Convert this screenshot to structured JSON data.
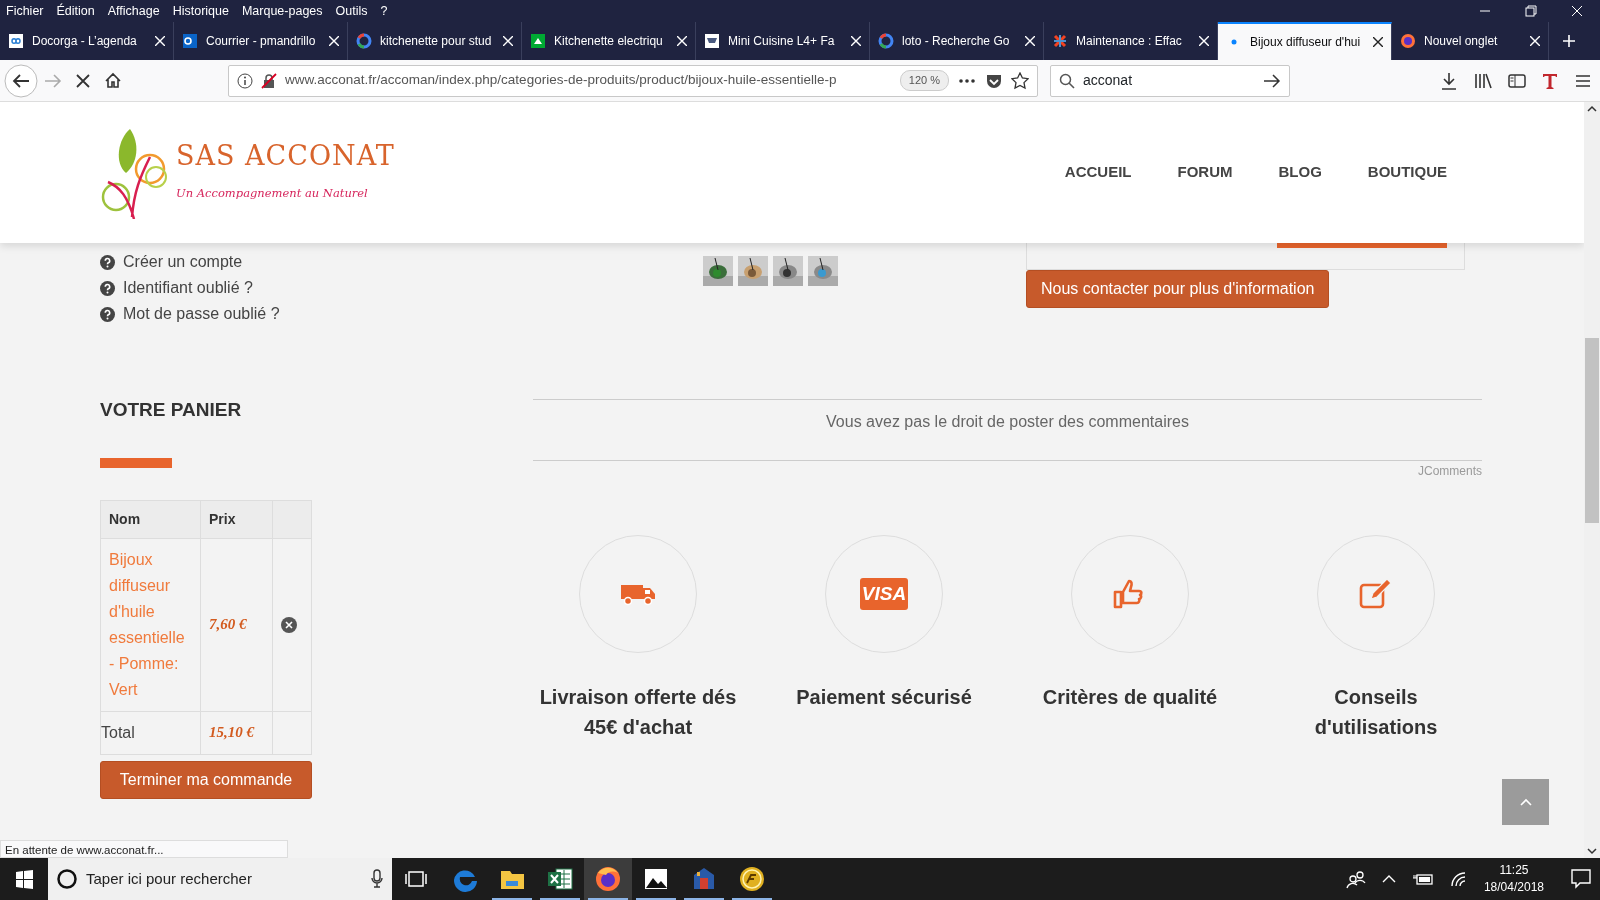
{
  "menu_bar": [
    "Fichier",
    "Édition",
    "Affichage",
    "Historique",
    "Marque-pages",
    "Outils",
    "?"
  ],
  "tabs": [
    {
      "title": "Docorga - L’agenda",
      "selected": false
    },
    {
      "title": "Courrier - pmandrillo",
      "selected": false
    },
    {
      "title": "kitchenette pour stud",
      "selected": false
    },
    {
      "title": "Kitchenette electriqu",
      "selected": false
    },
    {
      "title": "Mini Cuisine L4+ Fa",
      "selected": false
    },
    {
      "title": "loto - Recherche Go",
      "selected": false
    },
    {
      "title": "Maintenance : Effac",
      "selected": false
    },
    {
      "title": "Bijoux diffuseur d'hui",
      "selected": true
    },
    {
      "title": "Nouvel onglet",
      "selected": false
    }
  ],
  "address_bar": {
    "url": "www.acconat.fr/accoman/index.php/categories-de-produits/product/bijoux-huile-essentielle-p",
    "zoom": "120 %"
  },
  "search_box": {
    "value": "acconat"
  },
  "site": {
    "logo_title": "SAS ACCONAT",
    "logo_tagline": "Un Accompagnement au Naturel",
    "nav": [
      "ACCUEIL",
      "FORUM",
      "BLOG",
      "BOUTIQUE"
    ]
  },
  "account_links": [
    "Créer un compte",
    "Identifiant oublié ?",
    "Mot de passe oublié ?"
  ],
  "thumbnails": [
    {
      "kind": "picture"
    },
    {
      "kind": "picture"
    },
    {
      "kind": "picture"
    },
    {
      "kind": "picture"
    }
  ],
  "contact_button": "Nous contacter pour plus d'information",
  "comments": {
    "notice": "Vous avez pas le droit de poster des commentaires",
    "credit": "JComments"
  },
  "cart": {
    "heading": "VOTRE PANIER",
    "columns": [
      "Nom",
      "Prix"
    ],
    "items": [
      {
        "name": "Bijoux diffuseur d'huile essentielle - Pomme: Vert",
        "price": "7,60 €"
      }
    ],
    "total_label": "Total",
    "total": "15,10 €",
    "checkout": "Terminer ma commande"
  },
  "features": [
    {
      "title": "Livraison offerte dés 45€ d'achat"
    },
    {
      "title": "Paiement sécurisé",
      "icon_text": "VISA"
    },
    {
      "title": "Critères de qualité"
    },
    {
      "title": "Conseils d'utilisations"
    }
  ],
  "status_text": "En attente de www.acconat.fr...",
  "taskbar": {
    "search_placeholder": "Taper ici pour rechercher",
    "apps": [
      {
        "running": false,
        "selected": false
      },
      {
        "running": true,
        "selected": false
      },
      {
        "running": true,
        "selected": false
      },
      {
        "running": true,
        "selected": true
      },
      {
        "running": true,
        "selected": false
      },
      {
        "running": true,
        "selected": false
      },
      {
        "running": true,
        "selected": false
      }
    ],
    "time": "11:25",
    "date": "18/04/2018"
  }
}
